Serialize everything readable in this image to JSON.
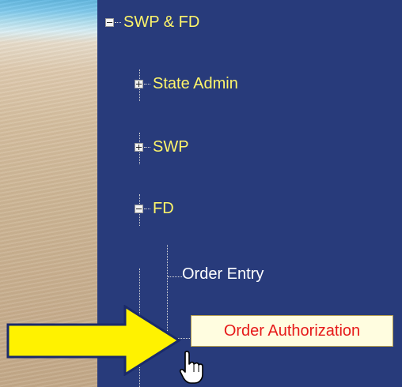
{
  "tree": {
    "root": {
      "label": "SWP & FD",
      "expanded": true
    },
    "children": [
      {
        "label": "State Admin",
        "expanded": false
      },
      {
        "label": "SWP",
        "expanded": false
      },
      {
        "label": "FD",
        "expanded": true
      }
    ],
    "fd_children": [
      {
        "label": "Order Entry"
      },
      {
        "label": "Order Authorization",
        "selected": true
      }
    ]
  },
  "colors": {
    "panel": "#283b7b",
    "tree_label": "#fff66a",
    "leaf_label": "#ffffff",
    "selected_text": "#e61919",
    "arrow": "#fff200"
  },
  "icons": {
    "arrow": "yellow-right-arrow-icon",
    "cursor": "hand-pointer-icon"
  }
}
